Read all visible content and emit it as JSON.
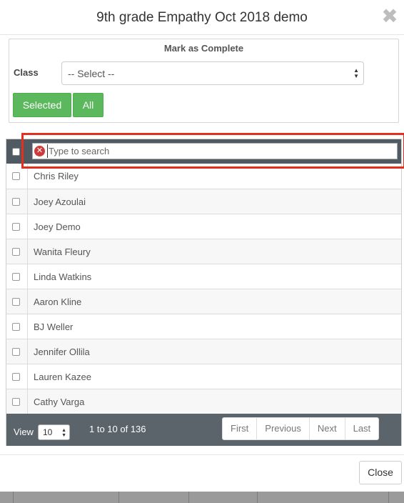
{
  "modal": {
    "title": "9th grade Empathy Oct 2018 demo",
    "close_glyph": "✖"
  },
  "mark_complete": {
    "title": "Mark as Complete",
    "class_label": "Class",
    "class_select_value": "-- Select --",
    "selected_button": "Selected",
    "all_button": "All"
  },
  "search": {
    "placeholder": "Type to search",
    "value": ""
  },
  "students": [
    {
      "name": "Chris Riley"
    },
    {
      "name": "Joey Azoulai"
    },
    {
      "name": "Joey Demo"
    },
    {
      "name": "Wanita Fleury"
    },
    {
      "name": "Linda Watkins"
    },
    {
      "name": "Aaron Kline"
    },
    {
      "name": "BJ Weller"
    },
    {
      "name": "Jennifer Ollila"
    },
    {
      "name": "Lauren Kazee"
    },
    {
      "name": "Cathy Varga"
    }
  ],
  "footer": {
    "view_label": "View",
    "page_size": "10",
    "range_text": "1 to 10 of 136",
    "pager": [
      "First",
      "Previous",
      "Next",
      "Last"
    ]
  },
  "modal_footer": {
    "close_label": "Close"
  },
  "colors": {
    "accent_green": "#5cb85c",
    "header_dark": "#4f5a63",
    "highlight_red": "#e52e1c"
  }
}
